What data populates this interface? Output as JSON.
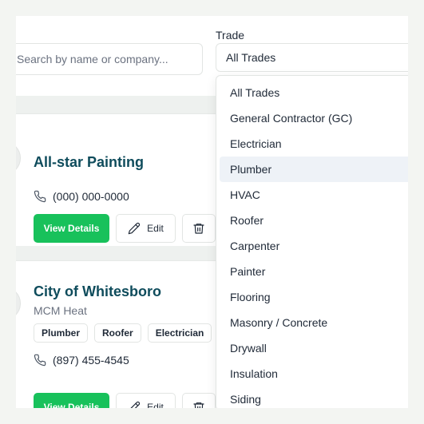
{
  "filters": {
    "search_placeholder": "Search by name or company...",
    "trade_label": "Trade",
    "trade_value": "All Trades"
  },
  "dropdown": {
    "highlighted": "Plumber",
    "options": [
      "All Trades",
      "General Contractor (GC)",
      "Electrician",
      "Plumber",
      "HVAC",
      "Roofer",
      "Carpenter",
      "Painter",
      "Flooring",
      "Masonry / Concrete",
      "Drywall",
      "Insulation",
      "Siding"
    ]
  },
  "cards": [
    {
      "title": "All-star Painting",
      "phone": "(000) 000-0000",
      "view_label": "View Details",
      "edit_label": "Edit"
    },
    {
      "title": "City of Whitesboro",
      "subtitle": "MCM Heat",
      "tags": [
        "Plumber",
        "Roofer",
        "Electrician"
      ],
      "phone": "(897) 455-4545",
      "view_label": "View Details",
      "edit_label": "Edit"
    }
  ],
  "colors": {
    "accent_green": "#18c15b",
    "title_teal": "#0f4c5c"
  }
}
